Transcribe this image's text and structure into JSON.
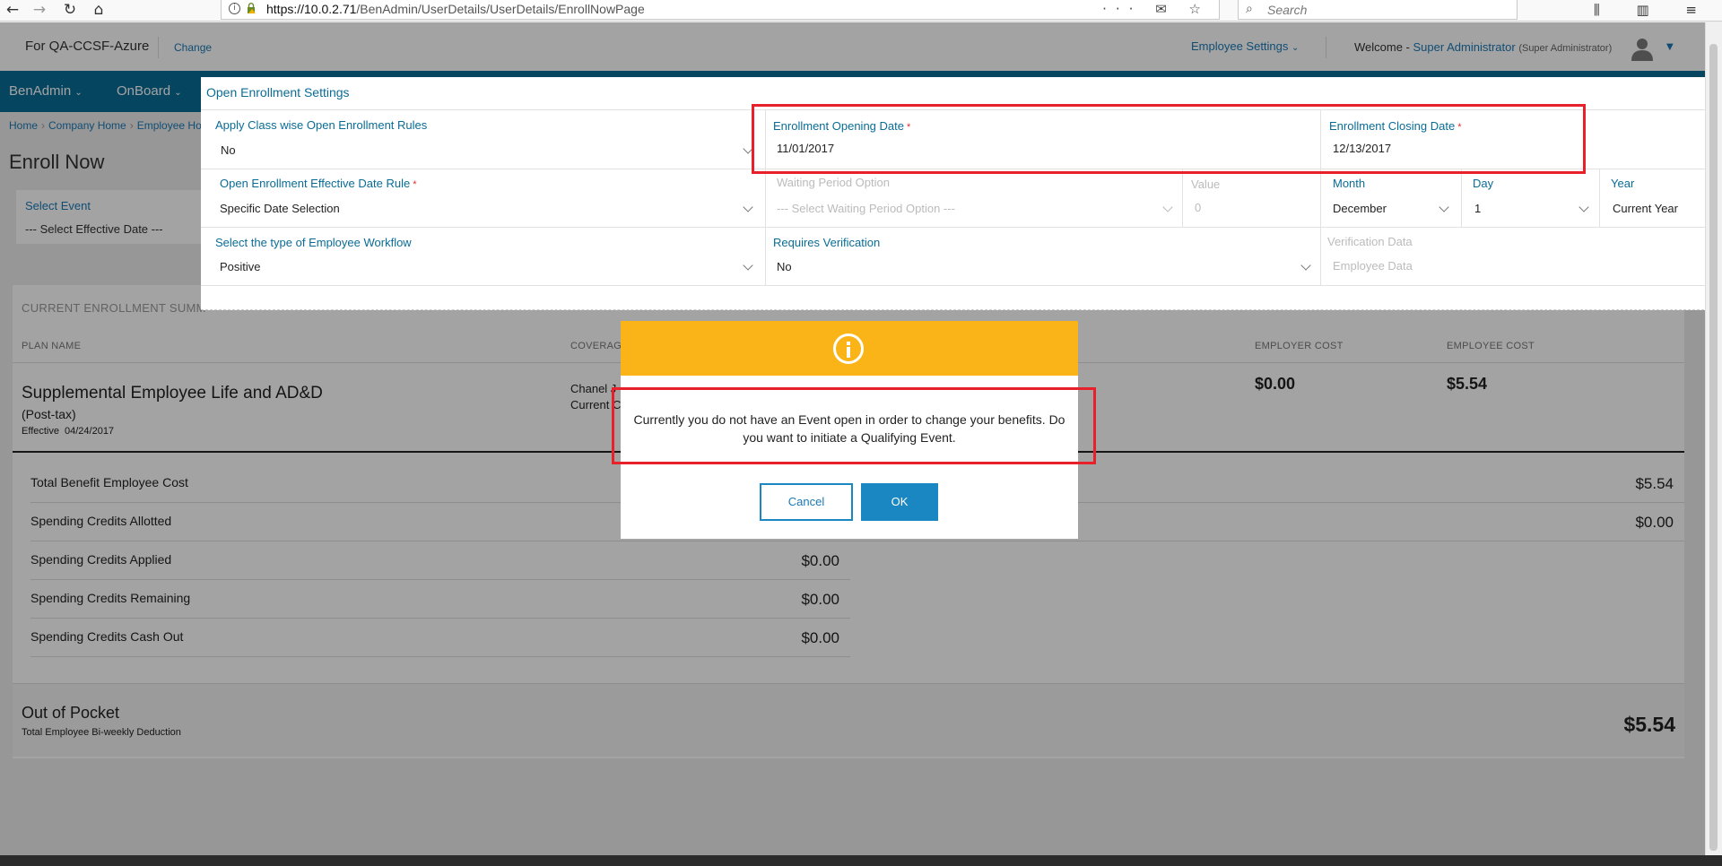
{
  "browser": {
    "url_host": "https://10.0.2.71",
    "url_path": "/BenAdmin/UserDetails/UserDetails/EnrollNowPage",
    "search_placeholder": "Search",
    "actions": "··· ✉ ☆",
    "right_icons": "⫼ ▥ ≡"
  },
  "header": {
    "tenant": "For QA-CCSF-Azure",
    "change": "Change",
    "employee_settings": "Employee Settings",
    "welcome": "Welcome -",
    "user_name": "Super Administrator",
    "user_role": "(Super Administrator)"
  },
  "nav": {
    "items": [
      "BenAdmin",
      "OnBoard"
    ]
  },
  "breadcrumb": [
    "Home",
    "Company Home",
    "Employee Ho"
  ],
  "page": {
    "title": "Enroll Now",
    "select_event_label": "Select Event",
    "select_event_value": "--- Select Effective Date ---"
  },
  "summary": {
    "heading": "CURRENT ENROLLMENT SUMM",
    "columns": {
      "plan_name": "PLAN NAME",
      "coverage": "COVERAG",
      "employer_cost": "EMPLOYER COST",
      "employee_cost": "EMPLOYEE COST"
    },
    "plan": {
      "name": "Supplemental Employee Life and AD&D",
      "tax": "(Post-tax)",
      "effective_label": "Effective",
      "effective_date": "04/24/2017",
      "coverage_line1": "Chanel J",
      "coverage_line2": "Current C",
      "employer_cost": "$0.00",
      "employee_cost": "$5.54"
    },
    "totals": [
      {
        "label": "Total Benefit Employee Cost",
        "amount": "$5.54"
      },
      {
        "label": "Spending Credits Allotted",
        "amount": "$0.00"
      },
      {
        "label": "Spending Credits Applied",
        "amount": "$0.00"
      },
      {
        "label": "Spending Credits Remaining",
        "amount": "$0.00"
      },
      {
        "label": "Spending Credits Cash Out",
        "amount": "$0.00"
      }
    ],
    "out_of_pocket": {
      "title": "Out of Pocket",
      "subtitle": "Total Employee Bi-weekly Deduction",
      "amount": "$5.54"
    }
  },
  "oe_settings": {
    "title": "Open Enrollment Settings",
    "class_rules_label": "Apply Class wise Open Enrollment Rules",
    "class_rules_value": "No",
    "opening_date_label": "Enrollment Opening Date",
    "opening_date_value": "11/01/2017",
    "closing_date_label": "Enrollment Closing Date",
    "closing_date_value": "12/13/2017",
    "required_mark": "*",
    "effective_rule_label": "Open Enrollment Effective Date Rule",
    "effective_rule_value": "Specific Date Selection",
    "waiting_period_label": "Waiting Period Option",
    "waiting_period_value": "--- Select Waiting Period Option ---",
    "value_label": "Value",
    "value_value": "0",
    "month_label": "Month",
    "month_value": "December",
    "day_label": "Day",
    "day_value": "1",
    "year_label": "Year",
    "year_value": "Current Year",
    "workflow_label": "Select the type of Employee Workflow",
    "workflow_value": "Positive",
    "verification_label": "Requires Verification",
    "verification_value": "No",
    "verification_data_label": "Verification Data",
    "verification_data_value": "Employee Data"
  },
  "dialog": {
    "message": "Currently you do not have an Event open in order to change your benefits. Do you want to initiate a Qualifying Event.",
    "cancel": "Cancel",
    "ok": "OK",
    "header_color": "#fbb417"
  }
}
